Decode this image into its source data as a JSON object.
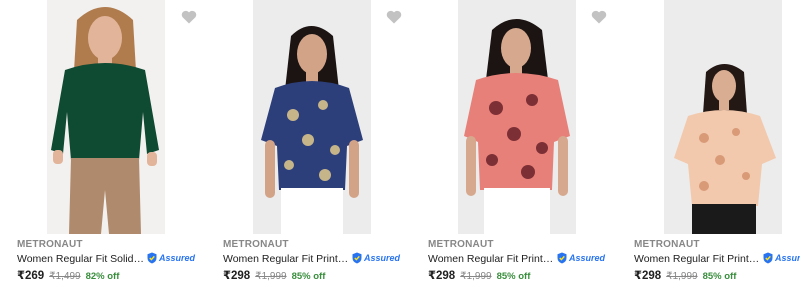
{
  "products": [
    {
      "brand": "METRONAUT",
      "title": "Women Regular Fit Solid Curved...",
      "assured_label": "Assured",
      "price": "₹269",
      "mrp": "₹1,499",
      "discount": "82% off",
      "colors": {
        "bg": "#f2f1ef",
        "top": "#0f4a32",
        "bottom": "#b08a6c",
        "skin": "#e2b59a",
        "hair": "#b07c4e"
      }
    },
    {
      "brand": "METRONAUT",
      "title": "Women Regular Fit Printed Spre...",
      "assured_label": "Assured",
      "price": "₹298",
      "mrp": "₹1,999",
      "discount": "85% off",
      "colors": {
        "bg": "#ececec",
        "top": "#2c3f7a",
        "print": "#c7b58a",
        "bottom": "#ffffff",
        "skin": "#d3a388",
        "hair": "#1c1412"
      }
    },
    {
      "brand": "METRONAUT",
      "title": "Women Regular Fit Printed Spre...",
      "assured_label": "Assured",
      "price": "₹298",
      "mrp": "₹1,999",
      "discount": "85% off",
      "colors": {
        "bg": "#ececec",
        "top": "#e8807a",
        "print": "#7c2f35",
        "bottom": "#ffffff",
        "skin": "#d6a88e",
        "hair": "#1c1412"
      }
    },
    {
      "brand": "METRONAUT",
      "title": "Women Regular Fit Printed Spre...",
      "assured_label": "Assured",
      "price": "₹298",
      "mrp": "₹1,999",
      "discount": "85% off",
      "colors": {
        "bg": "#ececec",
        "top": "#f2c9ad",
        "print": "#d99a78",
        "bottom": "#1a1a1a",
        "skin": "#d8ad92",
        "hair": "#241814"
      }
    }
  ]
}
